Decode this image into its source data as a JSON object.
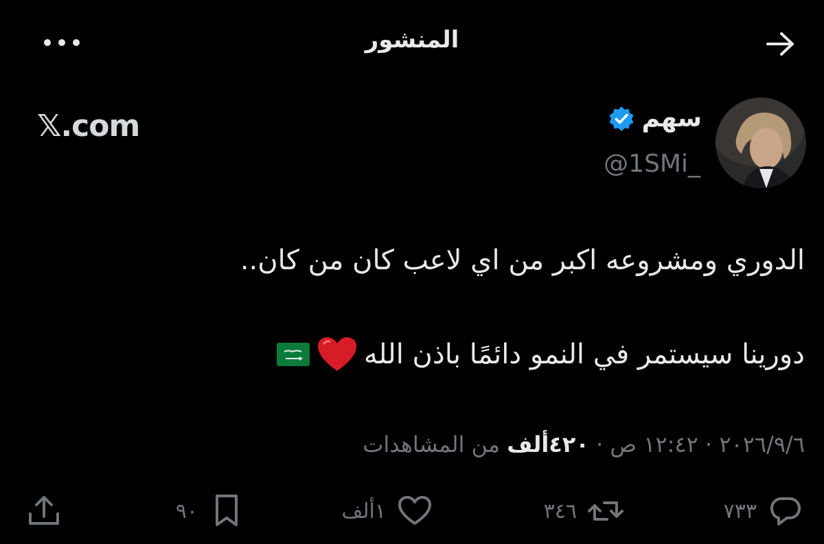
{
  "header": {
    "title": "المنشور"
  },
  "watermark": "𝕏.com",
  "author": {
    "name": "سهم",
    "handle": "@1SMi_"
  },
  "post": {
    "line1": "الدوري ومشروعه اكبر من اي لاعب كان من كان..",
    "line2": "دورينا سيستمر في النمو دائمًا باذن الله"
  },
  "meta": {
    "date": "٢٠٢٦/٩/٦",
    "time": "١٢:٤٢ ص",
    "views_count": "٤٢٠ألف",
    "views_label": "من المشاهدات",
    "separator": "·"
  },
  "actions": {
    "replies": "٧٣٣",
    "reposts": "٣٤٦",
    "likes": "١ألف",
    "bookmarks": "٩٠"
  },
  "icons": {
    "back": "arrow-right-icon",
    "more": "more-dots-icon",
    "verified": "verified-badge-icon",
    "heart": "red-heart-emoji",
    "flag": "saudi-flag-emoji",
    "reply": "reply-bubble-icon",
    "repost": "repost-icon",
    "like": "heart-outline-icon",
    "bookmark": "bookmark-icon",
    "share": "share-icon"
  },
  "colors": {
    "background": "#000000",
    "text": "#e7e9ea",
    "muted": "#71767b",
    "verified": "#1d9bf0"
  }
}
